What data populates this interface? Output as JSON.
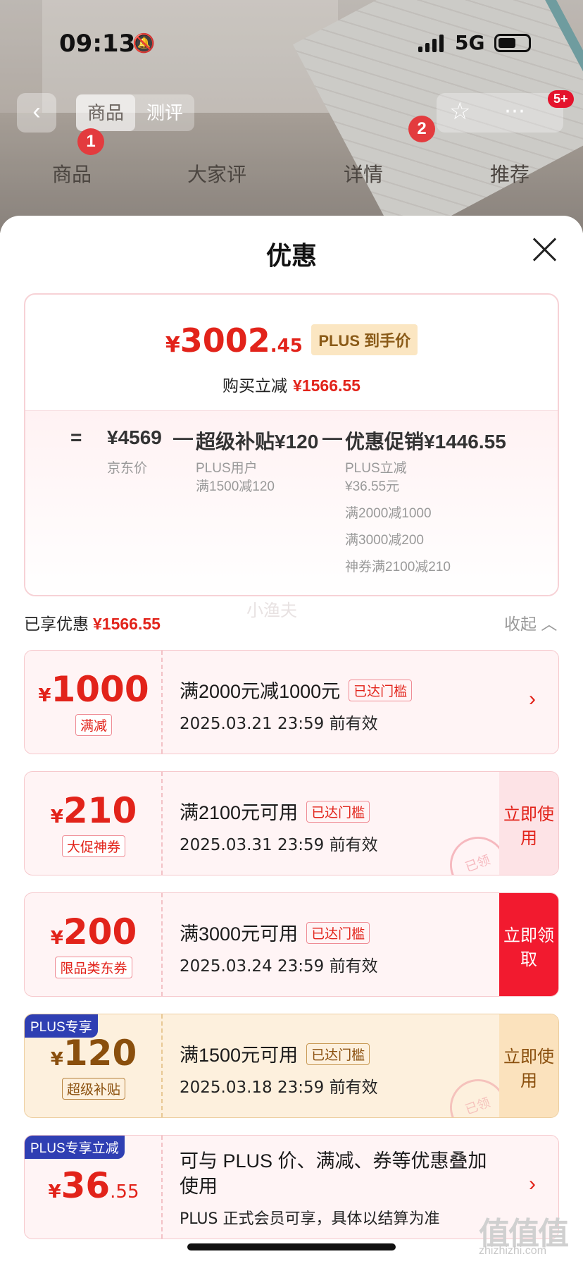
{
  "status_bar": {
    "time": "09:13",
    "network": "5G",
    "mute_icon": "bell-slash-icon"
  },
  "background": {
    "segment": [
      "商品",
      "测评"
    ],
    "cart_badge": "5+",
    "tabs": [
      "商品",
      "大家评",
      "详情",
      "推荐"
    ],
    "markers": [
      "1",
      "2"
    ]
  },
  "sheet": {
    "title": "优惠",
    "final_price": {
      "symbol": "¥",
      "integer": "3002",
      "decimal": ".45",
      "tag": "PLUS 到手价"
    },
    "save": {
      "label": "购买立减",
      "amount": "¥1566.55"
    },
    "breakdown": {
      "eq": "=",
      "jd_price": "¥4569",
      "jd_price_label": "京东价",
      "minus1": "—",
      "subsidy": "超级补贴¥120",
      "subsidy_lines": [
        "PLUS用户",
        "满1500减120"
      ],
      "minus2": "—",
      "promo": "优惠促销¥1446.55",
      "promo_lines": [
        "PLUS立减",
        "¥36.55元",
        "满2000减1000",
        "满3000减200",
        "神券满2100减210"
      ]
    },
    "enjoyed_label": "已享优惠",
    "enjoyed_amount": "¥1566.55",
    "watermark": "小渔夫",
    "collapse_label": "收起 ︿"
  },
  "coupons": [
    {
      "symbol": "¥",
      "amount": "1000",
      "decimal": "",
      "tag": "满减",
      "title": "满2000元减1000元",
      "status": "已达门槛",
      "date": "2025.03.21 23:59 前有效",
      "arrow": "›"
    },
    {
      "symbol": "¥",
      "amount": "210",
      "decimal": "",
      "tag": "大促神券",
      "title": "满2100元可用",
      "status": "已达门槛",
      "date": "2025.03.31 23:59 前有效",
      "action": "立即使用",
      "stamp": "已领"
    },
    {
      "symbol": "¥",
      "amount": "200",
      "decimal": "",
      "tag": "限品类东券",
      "title": "满3000元可用",
      "status": "已达门槛",
      "date": "2025.03.24 23:59 前有效",
      "action": "立即领取"
    },
    {
      "corner": "PLUS专享",
      "symbol": "¥",
      "amount": "120",
      "decimal": "",
      "tag": "超级补贴",
      "title": "满1500元可用",
      "status": "已达门槛",
      "date": "2025.03.18 23:59 前有效",
      "action": "立即使用",
      "stamp": "已领"
    },
    {
      "corner": "PLUS专享立减",
      "symbol": "¥",
      "amount": "36",
      "decimal": ".55",
      "title_line1": "可与 PLUS 价、满减、券等优惠叠加",
      "title_line2": "使用",
      "note": "PLUS 正式会员可享，具体以结算为准",
      "arrow": "›"
    }
  ],
  "site_watermark": {
    "logo": "值值值",
    "url": "zhizhizhi.com"
  },
  "colors": {
    "accent": "#e2231a",
    "plus_gold": "#8a4f0d",
    "plus_blue": "#2f3fb3"
  }
}
